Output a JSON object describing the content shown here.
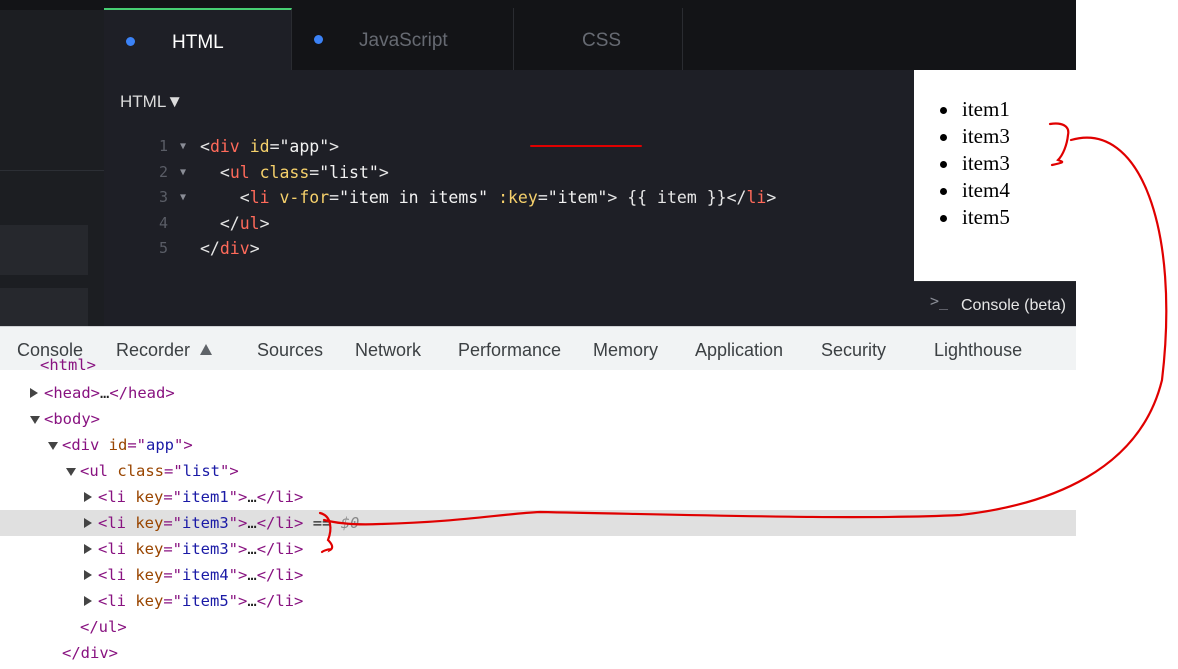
{
  "codepen": {
    "tabs": [
      {
        "label": "HTML",
        "active": true
      },
      {
        "label": "JavaScript",
        "active": false
      },
      {
        "label": "CSS",
        "active": false
      }
    ],
    "editor_title": "HTML▼",
    "code_lines": [
      {
        "num": "1",
        "parts": [
          [
            "c-br",
            "<"
          ],
          [
            "c-tag",
            "div"
          ],
          [
            "c-plain",
            " "
          ],
          [
            "c-attr",
            "id"
          ],
          [
            "c-br",
            "="
          ],
          [
            "c-val",
            "\"app\""
          ],
          [
            "c-br",
            ">"
          ]
        ]
      },
      {
        "num": "2",
        "parts": [
          [
            "c-plain",
            "  "
          ],
          [
            "c-br",
            "<"
          ],
          [
            "c-tag",
            "ul"
          ],
          [
            "c-plain",
            " "
          ],
          [
            "c-attr",
            "class"
          ],
          [
            "c-br",
            "="
          ],
          [
            "c-val",
            "\"list\""
          ],
          [
            "c-br",
            ">"
          ]
        ]
      },
      {
        "num": "3",
        "parts": [
          [
            "c-plain",
            "    "
          ],
          [
            "c-br",
            "<"
          ],
          [
            "c-tag",
            "li"
          ],
          [
            "c-plain",
            " "
          ],
          [
            "c-attr",
            "v-for"
          ],
          [
            "c-br",
            "="
          ],
          [
            "c-val",
            "\"item in items\""
          ],
          [
            "c-plain",
            " "
          ],
          [
            "c-attr",
            ":key"
          ],
          [
            "c-br",
            "="
          ],
          [
            "c-val",
            "\"item\""
          ],
          [
            "c-br",
            ">"
          ],
          [
            "c-plain",
            " {{ item }}"
          ],
          [
            "c-br",
            "</"
          ],
          [
            "c-tag",
            "li"
          ],
          [
            "c-br",
            ">"
          ]
        ]
      },
      {
        "num": "4",
        "parts": [
          [
            "c-plain",
            "  "
          ],
          [
            "c-br",
            "</"
          ],
          [
            "c-tag",
            "ul"
          ],
          [
            "c-br",
            ">"
          ]
        ]
      },
      {
        "num": "5",
        "parts": [
          [
            "c-br",
            "</"
          ],
          [
            "c-tag",
            "div"
          ],
          [
            "c-br",
            ">"
          ]
        ]
      }
    ],
    "preview_items": [
      "item1",
      "item3",
      "item3",
      "item4",
      "item5"
    ],
    "console_prompt": ">_",
    "console_label": "Console (beta)"
  },
  "devtools": {
    "tabs": [
      "Console",
      "Recorder",
      "Sources",
      "Network",
      "Performance",
      "Memory",
      "Application",
      "Security",
      "Lighthouse"
    ],
    "partial_top": "<html>",
    "nodes": [
      {
        "parts": [
          [
            "t-tag",
            "<head>"
          ],
          [
            "t-dim",
            "…"
          ],
          [
            "t-tag",
            "</head>"
          ]
        ]
      },
      {
        "parts": [
          [
            "t-tag",
            "<body>"
          ]
        ]
      },
      {
        "parts": [
          [
            "t-tag",
            "<div "
          ],
          [
            "t-attr",
            "id"
          ],
          [
            "t-tag",
            "=\""
          ],
          [
            "t-val",
            "app"
          ],
          [
            "t-tag",
            "\">"
          ]
        ]
      },
      {
        "parts": [
          [
            "t-tag",
            "<ul "
          ],
          [
            "t-attr",
            "class"
          ],
          [
            "t-tag",
            "=\""
          ],
          [
            "t-val",
            "list"
          ],
          [
            "t-tag",
            "\">"
          ]
        ]
      },
      {
        "parts": [
          [
            "t-tag",
            "<li "
          ],
          [
            "t-attr",
            "key"
          ],
          [
            "t-tag",
            "=\""
          ],
          [
            "t-val",
            "item1"
          ],
          [
            "t-tag",
            "\">"
          ],
          [
            "t-dim",
            "…"
          ],
          [
            "t-tag",
            "</li>"
          ]
        ]
      },
      {
        "parts": [
          [
            "t-tag",
            "<li "
          ],
          [
            "t-attr",
            "key"
          ],
          [
            "t-tag",
            "=\""
          ],
          [
            "t-val",
            "item3"
          ],
          [
            "t-tag",
            "\">"
          ],
          [
            "t-dim",
            "…"
          ],
          [
            "t-tag",
            "</li>"
          ],
          [
            "t-dim",
            " == "
          ],
          [
            "t-dollar",
            "$0"
          ]
        ]
      },
      {
        "parts": [
          [
            "t-tag",
            "<li "
          ],
          [
            "t-attr",
            "key"
          ],
          [
            "t-tag",
            "=\""
          ],
          [
            "t-val",
            "item3"
          ],
          [
            "t-tag",
            "\">"
          ],
          [
            "t-dim",
            "…"
          ],
          [
            "t-tag",
            "</li>"
          ]
        ]
      },
      {
        "parts": [
          [
            "t-tag",
            "<li "
          ],
          [
            "t-attr",
            "key"
          ],
          [
            "t-tag",
            "=\""
          ],
          [
            "t-val",
            "item4"
          ],
          [
            "t-tag",
            "\">"
          ],
          [
            "t-dim",
            "…"
          ],
          [
            "t-tag",
            "</li>"
          ]
        ]
      },
      {
        "parts": [
          [
            "t-tag",
            "<li "
          ],
          [
            "t-attr",
            "key"
          ],
          [
            "t-tag",
            "=\""
          ],
          [
            "t-val",
            "item5"
          ],
          [
            "t-tag",
            "\">"
          ],
          [
            "t-dim",
            "…"
          ],
          [
            "t-tag",
            "</li>"
          ]
        ]
      },
      {
        "parts": [
          [
            "t-tag",
            "</ul>"
          ]
        ]
      },
      {
        "parts": [
          [
            "t-tag",
            "</div>"
          ]
        ]
      }
    ]
  },
  "colors": {
    "annotation": "#e00000",
    "selection": "#e0e0e0",
    "tab_dot": "#3b82f6"
  }
}
